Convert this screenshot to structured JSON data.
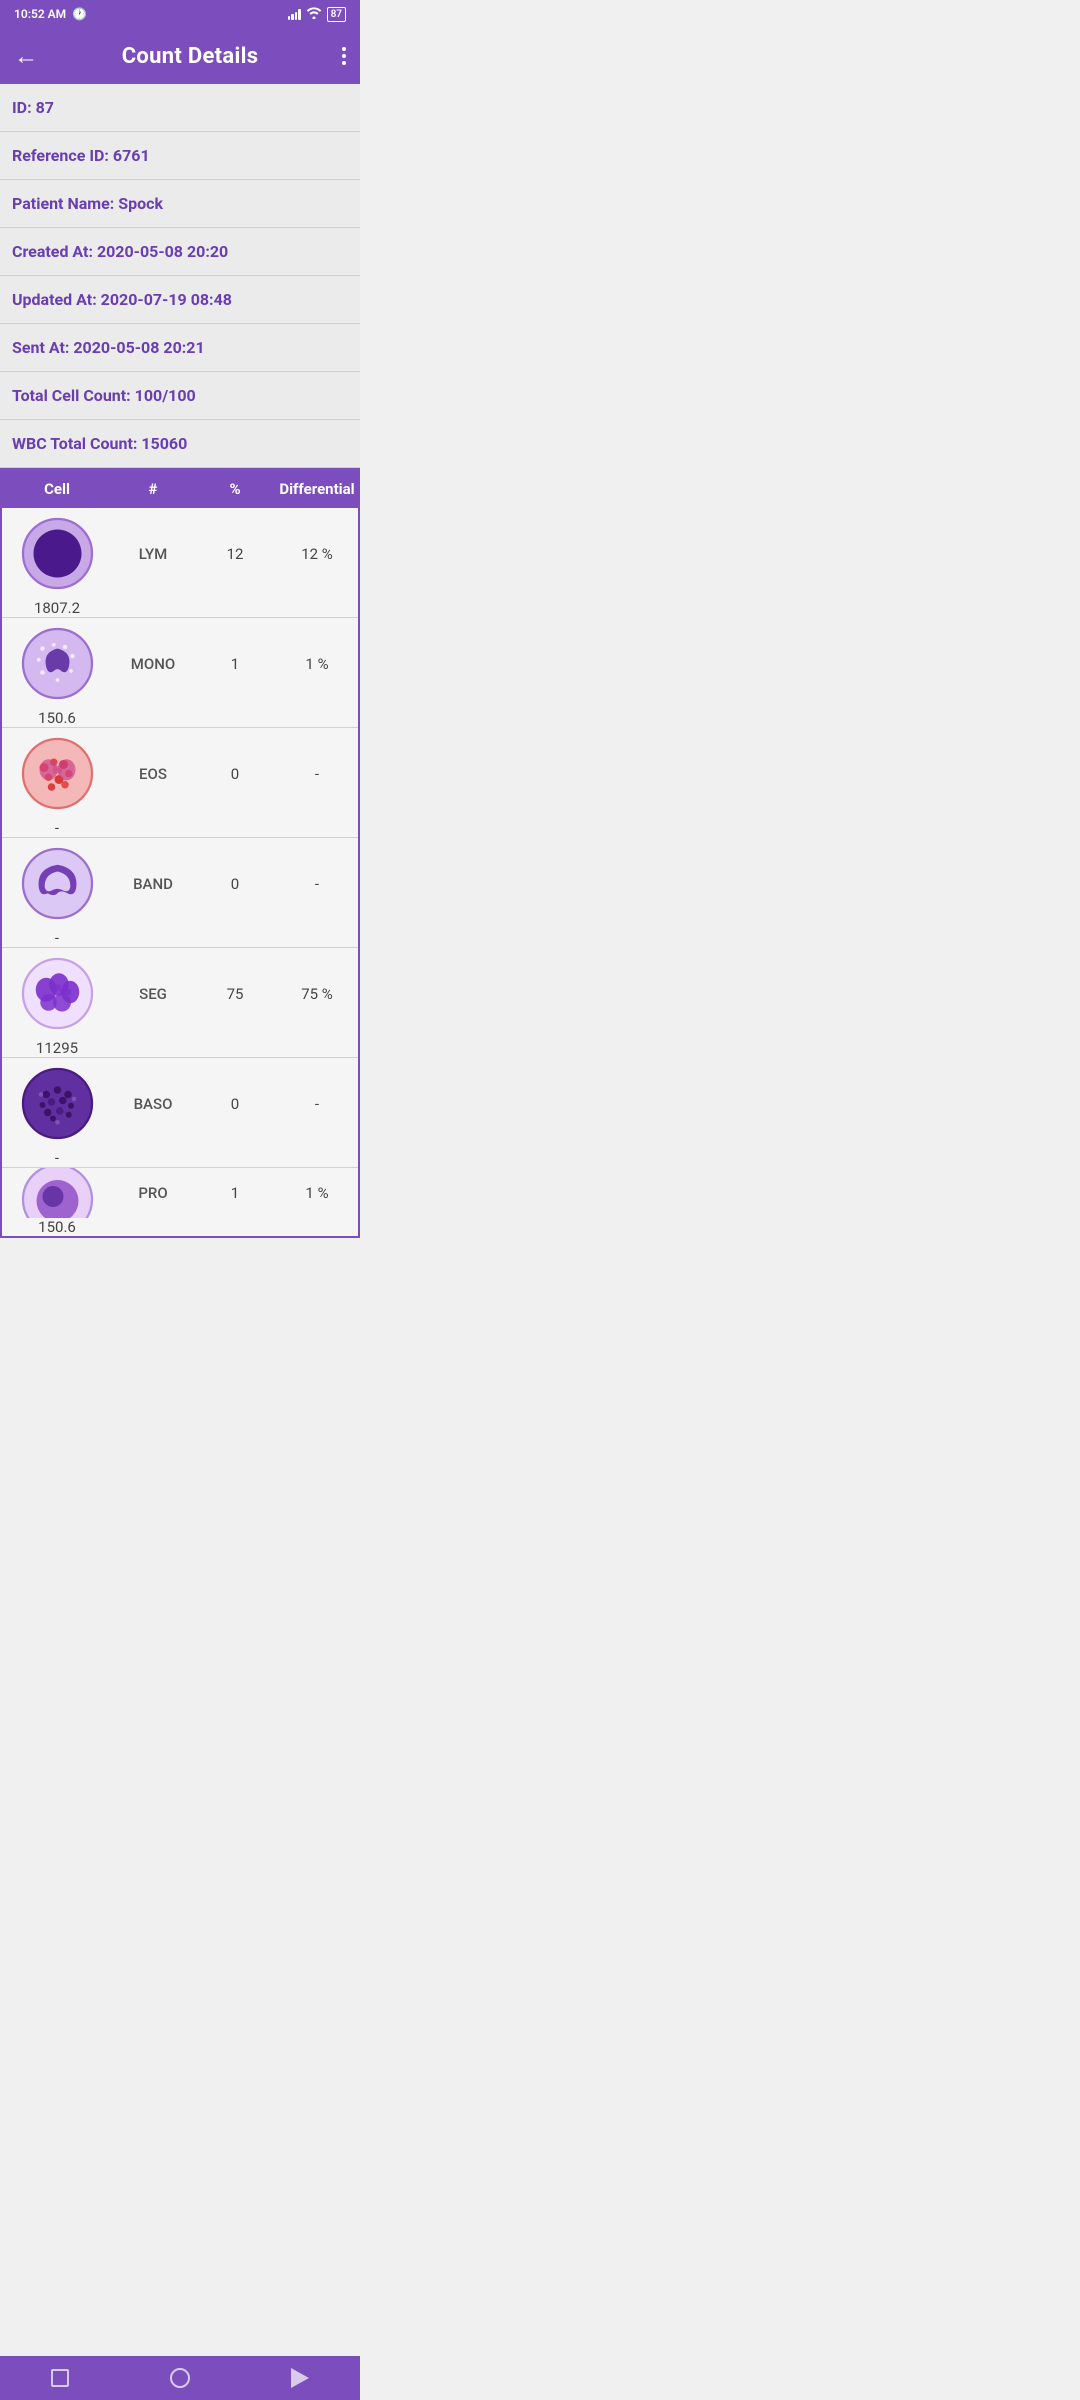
{
  "statusBar": {
    "time": "10:52 AM",
    "battery": "87"
  },
  "appBar": {
    "title": "Count Details",
    "backLabel": "←",
    "moreLabel": "⋮"
  },
  "info": [
    {
      "label": "ID: 87"
    },
    {
      "label": "Reference ID: 6761"
    },
    {
      "label": "Patient Name: Spock"
    },
    {
      "label": "Created At: 2020-05-08 20:20"
    },
    {
      "label": "Updated At: 2020-07-19 08:48"
    },
    {
      "label": "Sent At: 2020-05-08 20:21"
    },
    {
      "label": "Total Cell Count: 100/100"
    },
    {
      "label": "WBC Total Count: 15060"
    }
  ],
  "table": {
    "headers": [
      "Cell",
      "#",
      "%",
      "Differential"
    ],
    "rows": [
      {
        "name": "LYM",
        "count": "12",
        "pct": "12 %",
        "diff": "1807.2",
        "type": "lym"
      },
      {
        "name": "MONO",
        "count": "1",
        "pct": "1 %",
        "diff": "150.6",
        "type": "mono"
      },
      {
        "name": "EOS",
        "count": "0",
        "pct": "-",
        "diff": "-",
        "type": "eos"
      },
      {
        "name": "BAND",
        "count": "0",
        "pct": "-",
        "diff": "-",
        "type": "band"
      },
      {
        "name": "SEG",
        "count": "75",
        "pct": "75 %",
        "diff": "11295",
        "type": "seg"
      },
      {
        "name": "BASO",
        "count": "0",
        "pct": "-",
        "diff": "-",
        "type": "baso"
      },
      {
        "name": "PRO",
        "count": "1",
        "pct": "1 %",
        "diff": "150.6",
        "type": "pro"
      }
    ]
  }
}
